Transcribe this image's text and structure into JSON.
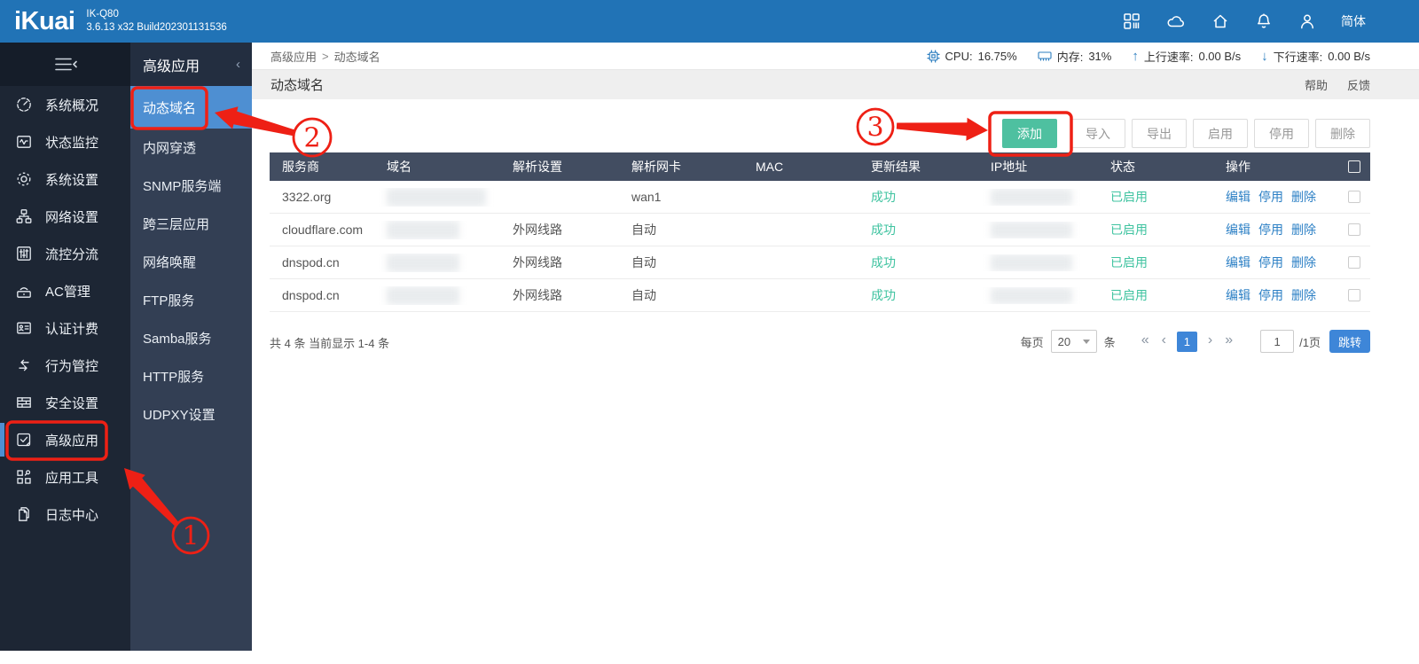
{
  "colors": {
    "header_blue": "#2173b6",
    "active_item_blue": "#4e8fd2",
    "table_header_bg": "#424d61",
    "success_green": "#3fc3a0",
    "add_button_green": "#4ec0a0",
    "link_blue": "#2d80c5",
    "pagination_blue": "#3e86d8",
    "annotation_red": "#ee2015"
  },
  "header": {
    "logo_text": "iKuai",
    "model": "IK-Q80",
    "build": "3.6.13 x32 Build202301131536",
    "language": "简体",
    "icons": [
      "apps-icon",
      "cloud-icon",
      "home-icon",
      "bell-icon",
      "user-icon"
    ]
  },
  "sidebar": {
    "collapse_icon": "hamburger-collapse-icon",
    "items": [
      {
        "label": "系统概况",
        "icon": "gauge-icon"
      },
      {
        "label": "状态监控",
        "icon": "monitor-icon"
      },
      {
        "label": "系统设置",
        "icon": "gear-icon"
      },
      {
        "label": "网络设置",
        "icon": "network-icon"
      },
      {
        "label": "流控分流",
        "icon": "sliders-icon"
      },
      {
        "label": "AC管理",
        "icon": "wifi-router-icon"
      },
      {
        "label": "认证计费",
        "icon": "id-card-icon"
      },
      {
        "label": "行为管控",
        "icon": "swap-arrows-icon"
      },
      {
        "label": "安全设置",
        "icon": "brick-wall-icon"
      },
      {
        "label": "高级应用",
        "icon": "check-square-icon",
        "active": true
      },
      {
        "label": "应用工具",
        "icon": "app-tools-icon"
      },
      {
        "label": "日志中心",
        "icon": "log-pages-icon"
      }
    ]
  },
  "submenu": {
    "title": "高级应用",
    "items": [
      {
        "label": "动态域名",
        "active": true
      },
      {
        "label": "内网穿透"
      },
      {
        "label": "SNMP服务端"
      },
      {
        "label": "跨三层应用"
      },
      {
        "label": "网络唤醒"
      },
      {
        "label": "FTP服务"
      },
      {
        "label": "Samba服务"
      },
      {
        "label": "HTTP服务"
      },
      {
        "label": "UDPXY设置"
      }
    ]
  },
  "breadcrumb": {
    "parent": "高级应用",
    "separator": ">",
    "current": "动态域名"
  },
  "statusbar": {
    "cpu_label": "CPU:",
    "cpu_value": "16.75%",
    "mem_label": "内存:",
    "mem_value": "31%",
    "up_arrow": "↑",
    "up_label": "上行速率:",
    "up_value": "0.00 B/s",
    "down_arrow": "↓",
    "down_label": "下行速率:",
    "down_value": "0.00 B/s"
  },
  "page": {
    "title": "动态域名",
    "help": "帮助",
    "feedback": "反馈"
  },
  "toolbar": {
    "add": "添加",
    "import": "导入",
    "export": "导出",
    "enable": "启用",
    "disable": "停用",
    "delete": "删除"
  },
  "table": {
    "headers": [
      "服务商",
      "域名",
      "解析设置",
      "解析网卡",
      "MAC",
      "更新结果",
      "IP地址",
      "状态",
      "操作"
    ],
    "rows": [
      {
        "provider": "3322.org",
        "resolve": "",
        "nic": "wan1",
        "mac": "",
        "result": "成功",
        "status": "已启用",
        "actions": [
          "编辑",
          "停用",
          "删除"
        ]
      },
      {
        "provider": "cloudflare.com",
        "resolve": "外网线路",
        "nic": "自动",
        "mac": "",
        "result": "成功",
        "status": "已启用",
        "actions": [
          "编辑",
          "停用",
          "删除"
        ]
      },
      {
        "provider": "dnspod.cn",
        "resolve": "外网线路",
        "nic": "自动",
        "mac": "",
        "result": "成功",
        "status": "已启用",
        "actions": [
          "编辑",
          "停用",
          "删除"
        ]
      },
      {
        "provider": "dnspod.cn",
        "resolve": "外网线路",
        "nic": "自动",
        "mac": "",
        "result": "成功",
        "status": "已启用",
        "actions": [
          "编辑",
          "停用",
          "删除"
        ]
      }
    ]
  },
  "pagination": {
    "summary": "共 4 条 当前显示 1-4 条",
    "per_page_label": "每页",
    "per_page_value": "20",
    "unit": "条",
    "first": "«",
    "prev": "‹",
    "current_page": "1",
    "next": "›",
    "last": "»",
    "jump_value": "1",
    "total_pages": "/1页",
    "jump_button": "跳转"
  },
  "annotations": {
    "step1": "1",
    "step2": "2",
    "step3": "3"
  }
}
